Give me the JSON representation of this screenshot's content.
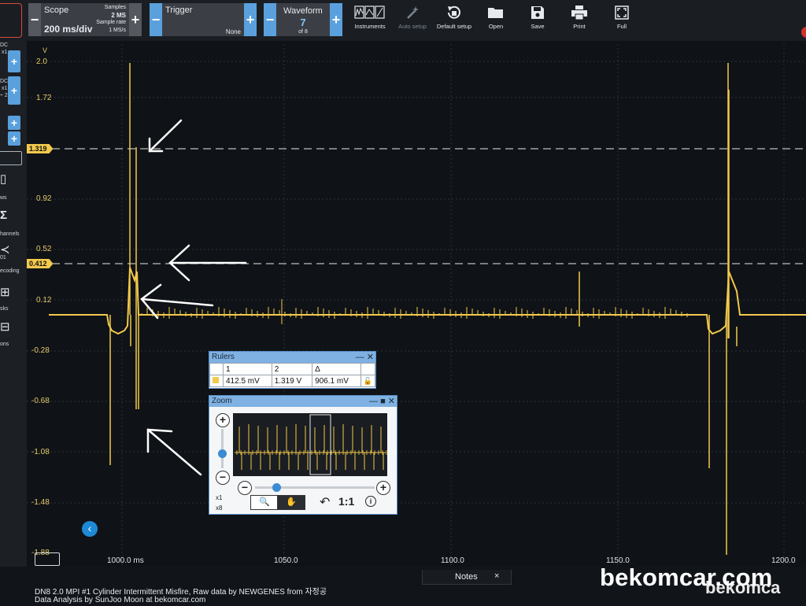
{
  "toolbar": {
    "scope": {
      "label": "Scope",
      "timebase": "200 ms/div",
      "samples_label": "Samples",
      "samples_value": "2 MS",
      "rate_label": "Sample rate",
      "rate_value": "1 MS/s"
    },
    "trigger": {
      "label": "Trigger",
      "mode": "None"
    },
    "waveform": {
      "label": "Waveform",
      "index": "7",
      "of": "of 8"
    },
    "tools": [
      "Instruments",
      "Auto setup",
      "Default setup",
      "Open",
      "Save",
      "Print",
      "Full"
    ]
  },
  "side": {
    "ch1_line1": "DC",
    "ch1_line2": "x1",
    "ch2_line1": "DC",
    "ch2_line2": "x1",
    "ch2_line3": "÷ 2",
    "items": [
      "ws",
      "hannels",
      "01",
      "ecoding",
      "sks",
      "ons"
    ]
  },
  "plot": {
    "unit": "V",
    "y_labels": [
      "2.0",
      "1.72",
      "1.32",
      "0.92",
      "0.52",
      "0.12",
      "-0.28",
      "-0.68",
      "-1.08",
      "-1.48",
      "-1.88"
    ],
    "x_labels": [
      "1000.0 ms",
      "1050.0",
      "1100.0",
      "1150.0",
      "1200.0"
    ],
    "ruler_tags": [
      "1.319",
      "0.412"
    ],
    "trace_color": "#f2c94c"
  },
  "rulers": {
    "title": "Rulers",
    "headers": [
      "1",
      "2",
      "Δ"
    ],
    "values": [
      "412.5 mV",
      "1.319 V",
      "906.1 mV"
    ]
  },
  "zoom": {
    "title": "Zoom",
    "x1": "x1",
    "x8": "x8",
    "ratio": "1:1"
  },
  "notes": {
    "label": "Notes",
    "close": "×"
  },
  "caption": {
    "line1": "DN8 2.0 MPI #1 Cylinder Intermittent Misfire, Raw data by NEWGENES from 자정공",
    "line2": "Data Analysis by SunJoo Moon at bekomcar.com"
  },
  "watermark": {
    "main": "bekomcar.com",
    "ghost": "bekomca"
  }
}
